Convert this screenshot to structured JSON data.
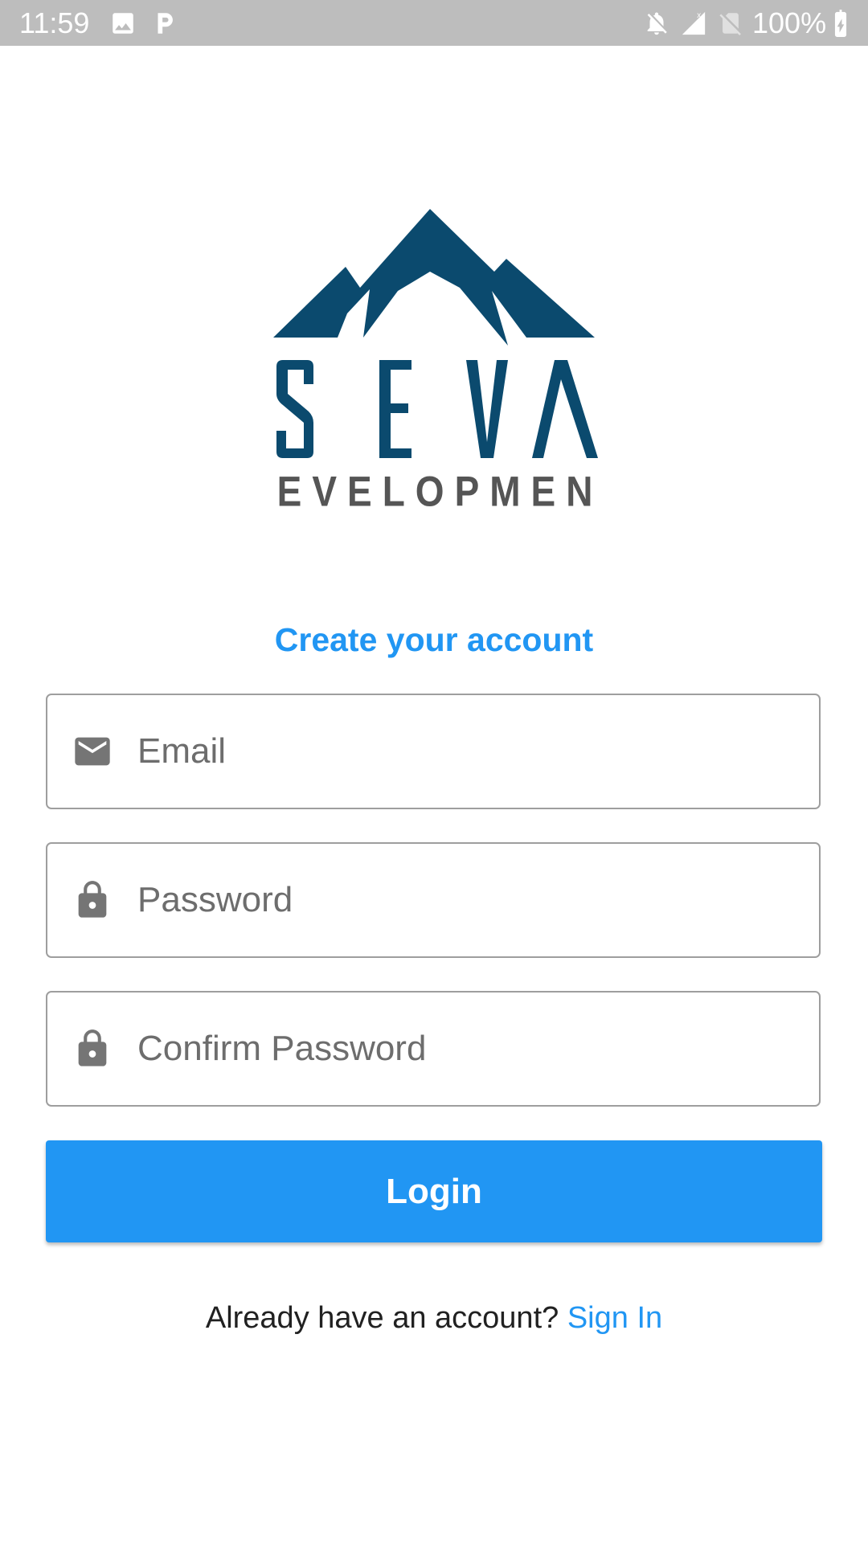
{
  "status_bar": {
    "time": "11:59",
    "battery": "100%",
    "icons": [
      "image-icon",
      "parking-icon",
      "notifications-off-icon",
      "signal-icon",
      "no-sim-icon",
      "battery-charging-icon"
    ]
  },
  "logo": {
    "wordmark": "SEVA",
    "subtitle": "DEVELOPMENT",
    "color_primary": "#0b4a6e",
    "color_secondary": "#555555"
  },
  "form": {
    "heading": "Create your account",
    "email_placeholder": "Email",
    "password_placeholder": "Password",
    "confirm_placeholder": "Confirm Password",
    "login_label": "Login"
  },
  "footer": {
    "prompt": "Already have an account?",
    "link_label": "Sign In"
  },
  "colors": {
    "accent": "#2196f3",
    "field_border": "#9e9e9e",
    "icon_gray": "#757575"
  }
}
